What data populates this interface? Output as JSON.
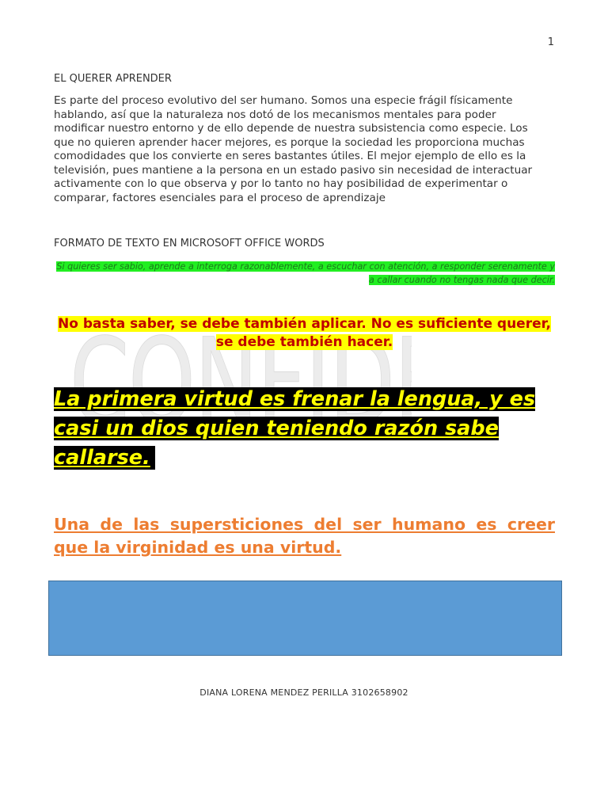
{
  "page": {
    "number": "1"
  },
  "watermark": {
    "text": "CONFIDENCIAL"
  },
  "section1": {
    "heading": "EL QUERER APRENDER",
    "paragraph": "Es parte del proceso evolutivo del ser humano. Somos una especie frágil físicamente hablando, así que la naturaleza nos dotó de los mecanismos mentales para poder modificar nuestro entorno y de ello depende de nuestra subsistencia como especie. Los que no quieren aprender hacer mejores, es porque la sociedad les proporciona muchas comodidades que los convierte en seres bastantes útiles. El mejor ejemplo de ello es la televisión, pues mantiene a la persona en un estado pasivo sin necesidad de interactuar activamente con lo que observa y por lo tanto no hay posibilidad de experimentar o comparar, factores esenciales para el proceso de aprendizaje"
  },
  "section2": {
    "heading": "FORMATO DE TEXTO EN MICROSOFT OFFICE WORDS",
    "quote_green": "Si quieres ser sabio, aprende a interroga razonablemente, a escuchar con atención, a responder serenamente y a callar cuando no tengas nada que decir.",
    "quote_yellow": "No basta saber, se debe también aplicar. No es suficiente querer, se debe también hacer.",
    "quote_black": "La primera virtud es frenar la lengua, y es casi un dios quien teniendo razón sabe callarse.",
    "quote_orange": "Una de las supersticiones del ser humano es creer que la virginidad es una virtud."
  },
  "colors": {
    "green_highlight": "#22ee22",
    "yellow_highlight": "#ffff00",
    "red_text": "#c00000",
    "orange_text": "#ed7d31",
    "blue_box": "#5b9bd5"
  },
  "footer": {
    "author_line": "DIANA LORENA MENDEZ PERILLA  3102658902"
  }
}
